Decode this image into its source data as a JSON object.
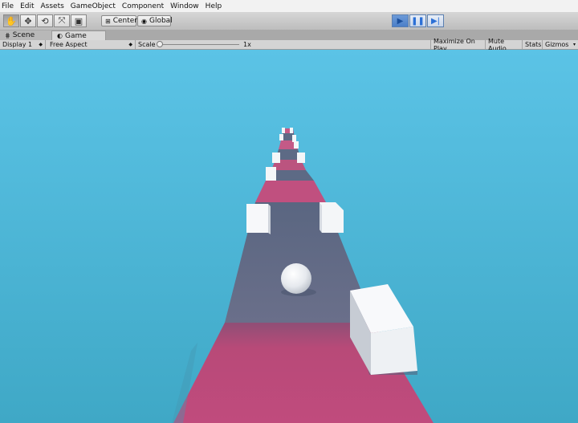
{
  "menu": [
    "File",
    "Edit",
    "Assets",
    "GameObject",
    "Component",
    "Window",
    "Help"
  ],
  "toolbar": {
    "tools": [
      "hand-icon",
      "move-icon",
      "rotate-icon",
      "scale-icon",
      "rect-icon"
    ],
    "pivot_label": "Center",
    "space_label": "Global"
  },
  "playback": {
    "play": "▶",
    "pause": "❚❚",
    "step": "▶|",
    "is_playing": true
  },
  "tabs": {
    "scene": "Scene",
    "game": "Game"
  },
  "gamebar": {
    "display": "Display 1",
    "aspect": "Free Aspect",
    "scale_label": "Scale",
    "scale_value": "1x",
    "maximize": "Maximize On Play",
    "mute": "Mute Audio",
    "stats": "Stats",
    "gizmos": "Gizmos"
  },
  "colors": {
    "sky": "#58bfe0",
    "track_pink": "#b94e7b",
    "track_slate": "#5d6a85",
    "block": "#f4f6f8"
  }
}
